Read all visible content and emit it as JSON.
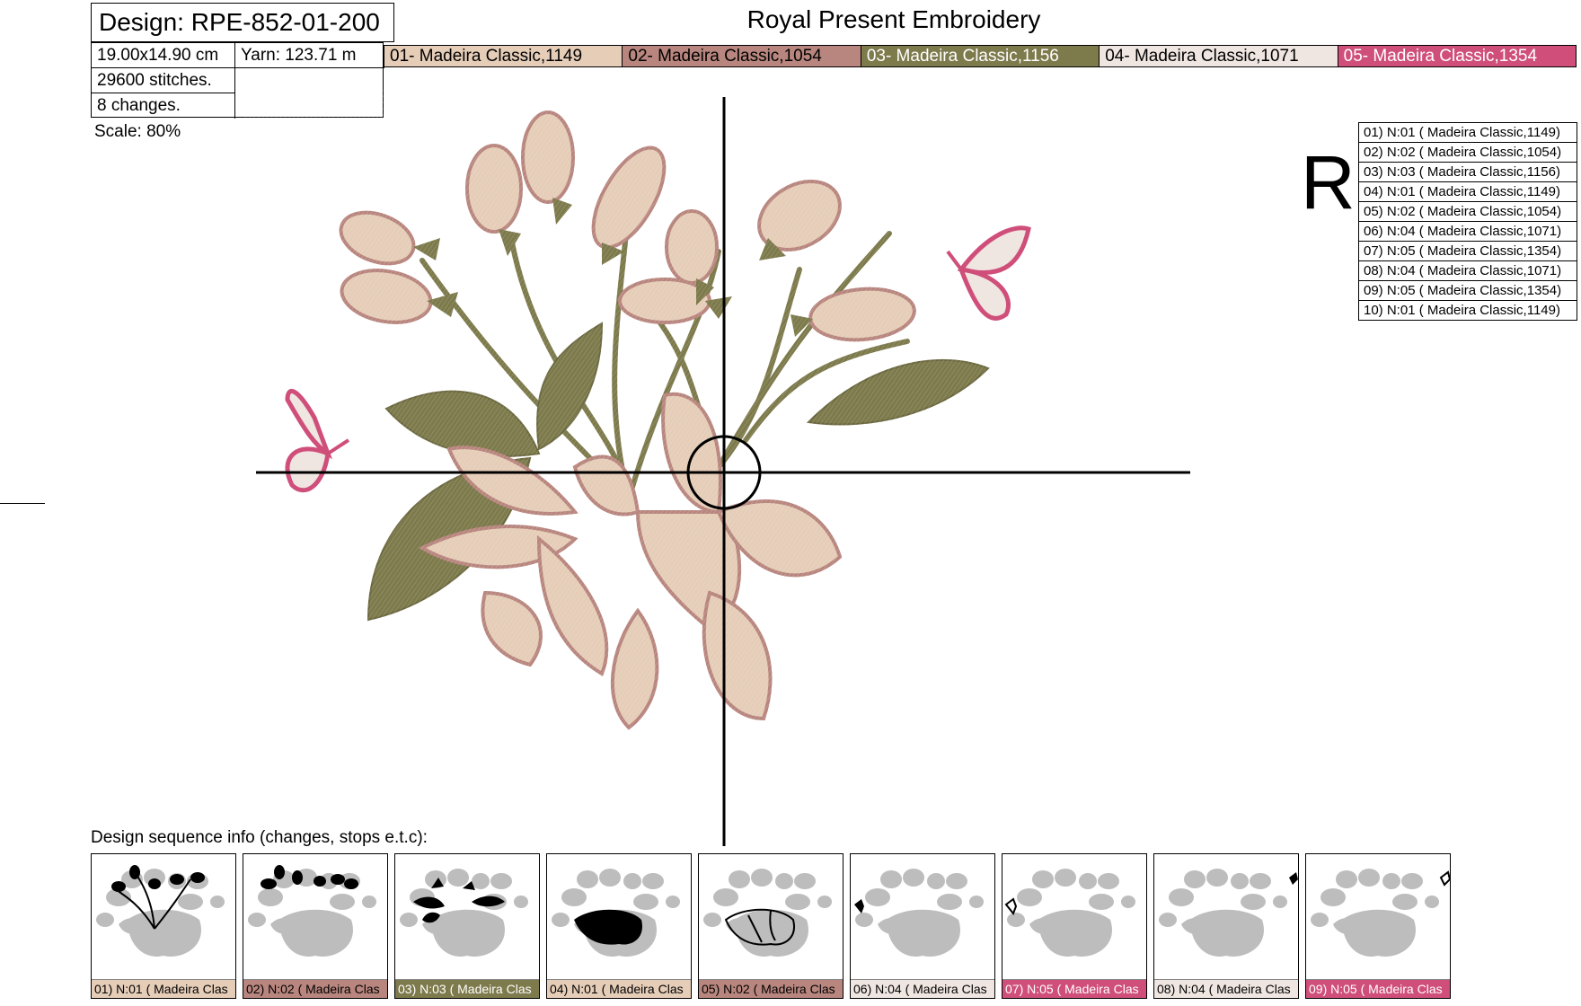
{
  "header": {
    "design_label": "Design: RPE-852-01-200",
    "size": "19.00x14.90 cm",
    "yarn": "Yarn: 123.71 m",
    "stitches": "29600 stitches.",
    "changes": "8 changes.",
    "company": "Royal Present Embroidery",
    "scale": "Scale: 80%"
  },
  "colors": [
    {
      "label": "01- Madeira Classic,1149",
      "hex": "#e5cdb8",
      "text": "#000000"
    },
    {
      "label": "02- Madeira Classic,1054",
      "hex": "#b8867e",
      "text": "#000000"
    },
    {
      "label": "03- Madeira Classic,1156",
      "hex": "#7d7a4c",
      "text": "#ffffff"
    },
    {
      "label": "04- Madeira Classic,1071",
      "hex": "#efe6e1",
      "text": "#000000"
    },
    {
      "label": "05- Madeira Classic,1354",
      "hex": "#cf4f7a",
      "text": "#ffffff"
    }
  ],
  "sequence_list": [
    "01) N:01 ( Madeira Classic,1149)",
    "02) N:02 ( Madeira Classic,1054)",
    "03) N:03 ( Madeira Classic,1156)",
    "04) N:01 ( Madeira Classic,1149)",
    "05) N:02 ( Madeira Classic,1054)",
    "06) N:04 ( Madeira Classic,1071)",
    "07) N:05 ( Madeira Classic,1354)",
    "08) N:04 ( Madeira Classic,1071)",
    "09) N:05 ( Madeira Classic,1354)",
    "10) N:01 ( Madeira Classic,1149)"
  ],
  "r_letter": "R",
  "sequence_title": "Design sequence info (changes, stops e.t.c):",
  "thumbnails": [
    {
      "label": "01) N:01 ( Madeira Clas",
      "color": "#e5cdb8",
      "text": "#000000",
      "part": "stems"
    },
    {
      "label": "02) N:02 ( Madeira Clas",
      "color": "#b8867e",
      "text": "#000000",
      "part": "buds"
    },
    {
      "label": "03) N:03 ( Madeira Clas",
      "color": "#7d7a4c",
      "text": "#ffffff",
      "part": "leaves"
    },
    {
      "label": "04) N:01 ( Madeira Clas",
      "color": "#e5cdb8",
      "text": "#000000",
      "part": "flower-fill"
    },
    {
      "label": "05) N:02 ( Madeira Clas",
      "color": "#b8867e",
      "text": "#000000",
      "part": "flower-outline"
    },
    {
      "label": "06) N:04 ( Madeira Clas",
      "color": "#efe6e1",
      "text": "#000000",
      "part": "left-butterfly"
    },
    {
      "label": "07) N:05 ( Madeira Clas",
      "color": "#cf4f7a",
      "text": "#ffffff",
      "part": "left-butterfly-outline"
    },
    {
      "label": "08) N:04 ( Madeira Clas",
      "color": "#efe6e1",
      "text": "#000000",
      "part": "right-butterfly"
    },
    {
      "label": "09) N:05 ( Madeira Clas",
      "color": "#cf4f7a",
      "text": "#ffffff",
      "part": "right-butterfly-outline"
    }
  ]
}
